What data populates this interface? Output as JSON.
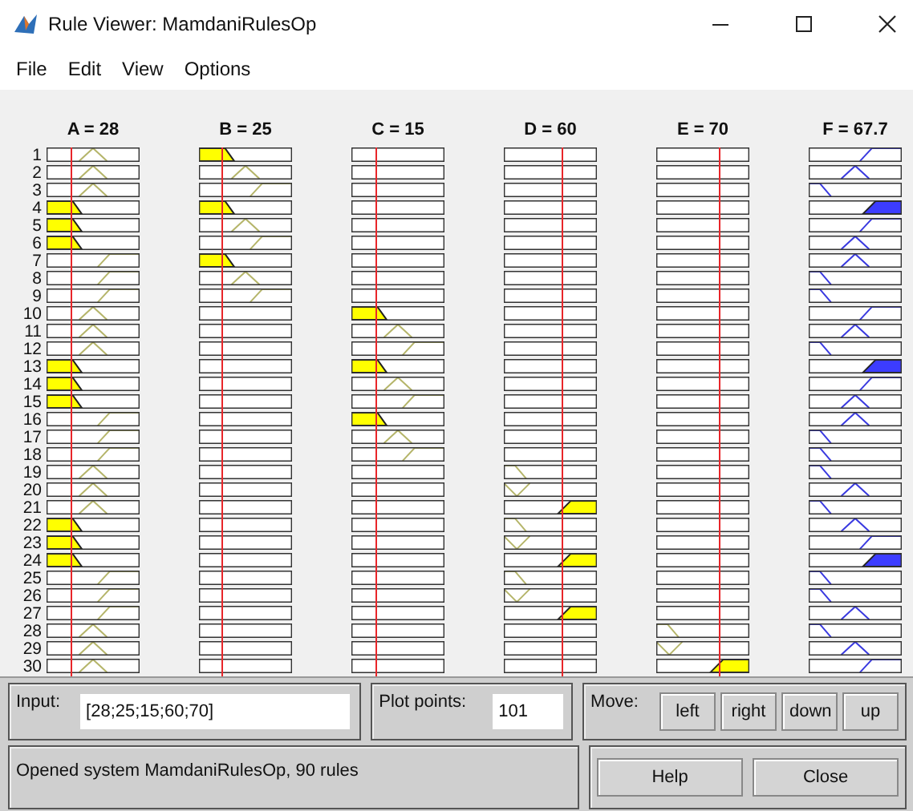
{
  "window": {
    "title": "Rule Viewer: MamdaniRulesOp"
  },
  "menu": [
    "File",
    "Edit",
    "View",
    "Options"
  ],
  "rule_numbers": [
    "1",
    "2",
    "3",
    "4",
    "5",
    "6",
    "7",
    "8",
    "9",
    "10",
    "11",
    "12",
    "13",
    "14",
    "15",
    "16",
    "17",
    "18",
    "19",
    "20",
    "21",
    "22",
    "23",
    "24",
    "25",
    "26",
    "27",
    "28",
    "29",
    "30"
  ],
  "columns": [
    {
      "title": "A = 28",
      "kind": "input",
      "rules": [
        {
          "kind": "mid"
        },
        {
          "kind": "mid"
        },
        {
          "kind": "mid"
        },
        {
          "kind": "low-fired"
        },
        {
          "kind": "low-fired"
        },
        {
          "kind": "low-fired"
        },
        {
          "kind": "high"
        },
        {
          "kind": "high"
        },
        {
          "kind": "high"
        },
        {
          "kind": "mid"
        },
        {
          "kind": "mid"
        },
        {
          "kind": "mid"
        },
        {
          "kind": "low-fired"
        },
        {
          "kind": "low-fired"
        },
        {
          "kind": "low-fired"
        },
        {
          "kind": "high"
        },
        {
          "kind": "high"
        },
        {
          "kind": "high"
        },
        {
          "kind": "mid"
        },
        {
          "kind": "mid"
        },
        {
          "kind": "mid"
        },
        {
          "kind": "low-fired"
        },
        {
          "kind": "low-fired"
        },
        {
          "kind": "low-fired"
        },
        {
          "kind": "high"
        },
        {
          "kind": "high"
        },
        {
          "kind": "high"
        },
        {
          "kind": "mid"
        },
        {
          "kind": "mid"
        },
        {
          "kind": "mid"
        }
      ]
    },
    {
      "title": "B = 25",
      "kind": "input",
      "rules": [
        {
          "kind": "low-fired"
        },
        {
          "kind": "mid"
        },
        {
          "kind": "high"
        },
        {
          "kind": "low-fired"
        },
        {
          "kind": "mid"
        },
        {
          "kind": "high"
        },
        {
          "kind": "low-fired"
        },
        {
          "kind": "mid"
        },
        {
          "kind": "high"
        },
        {
          "kind": "empty"
        },
        {
          "kind": "empty"
        },
        {
          "kind": "empty"
        },
        {
          "kind": "empty"
        },
        {
          "kind": "empty"
        },
        {
          "kind": "empty"
        },
        {
          "kind": "empty"
        },
        {
          "kind": "empty"
        },
        {
          "kind": "empty"
        },
        {
          "kind": "empty"
        },
        {
          "kind": "empty"
        },
        {
          "kind": "empty"
        },
        {
          "kind": "empty"
        },
        {
          "kind": "empty"
        },
        {
          "kind": "empty"
        },
        {
          "kind": "empty"
        },
        {
          "kind": "empty"
        },
        {
          "kind": "empty"
        },
        {
          "kind": "empty"
        },
        {
          "kind": "empty"
        },
        {
          "kind": "empty"
        }
      ]
    },
    {
      "title": "C = 15",
      "kind": "input",
      "rules": [
        {
          "kind": "empty"
        },
        {
          "kind": "empty"
        },
        {
          "kind": "empty"
        },
        {
          "kind": "empty"
        },
        {
          "kind": "empty"
        },
        {
          "kind": "empty"
        },
        {
          "kind": "empty"
        },
        {
          "kind": "empty"
        },
        {
          "kind": "empty"
        },
        {
          "kind": "low-fired"
        },
        {
          "kind": "mid"
        },
        {
          "kind": "high"
        },
        {
          "kind": "low-fired"
        },
        {
          "kind": "mid"
        },
        {
          "kind": "high"
        },
        {
          "kind": "low-fired"
        },
        {
          "kind": "mid"
        },
        {
          "kind": "high"
        },
        {
          "kind": "empty"
        },
        {
          "kind": "empty"
        },
        {
          "kind": "empty"
        },
        {
          "kind": "empty"
        },
        {
          "kind": "empty"
        },
        {
          "kind": "empty"
        },
        {
          "kind": "empty"
        },
        {
          "kind": "empty"
        },
        {
          "kind": "empty"
        },
        {
          "kind": "empty"
        },
        {
          "kind": "empty"
        },
        {
          "kind": "empty"
        }
      ]
    },
    {
      "title": "D = 60",
      "kind": "input",
      "rules": [
        {
          "kind": "empty"
        },
        {
          "kind": "empty"
        },
        {
          "kind": "empty"
        },
        {
          "kind": "empty"
        },
        {
          "kind": "empty"
        },
        {
          "kind": "empty"
        },
        {
          "kind": "empty"
        },
        {
          "kind": "empty"
        },
        {
          "kind": "empty"
        },
        {
          "kind": "empty"
        },
        {
          "kind": "empty"
        },
        {
          "kind": "empty"
        },
        {
          "kind": "empty"
        },
        {
          "kind": "empty"
        },
        {
          "kind": "empty"
        },
        {
          "kind": "empty"
        },
        {
          "kind": "empty"
        },
        {
          "kind": "empty"
        },
        {
          "kind": "low"
        },
        {
          "kind": "mid-left"
        },
        {
          "kind": "high-fired"
        },
        {
          "kind": "low"
        },
        {
          "kind": "mid-left"
        },
        {
          "kind": "high-fired"
        },
        {
          "kind": "low"
        },
        {
          "kind": "mid-left"
        },
        {
          "kind": "high-fired"
        },
        {
          "kind": "empty"
        },
        {
          "kind": "empty"
        },
        {
          "kind": "empty"
        }
      ]
    },
    {
      "title": "E = 70",
      "kind": "input",
      "rules": [
        {
          "kind": "empty"
        },
        {
          "kind": "empty"
        },
        {
          "kind": "empty"
        },
        {
          "kind": "empty"
        },
        {
          "kind": "empty"
        },
        {
          "kind": "empty"
        },
        {
          "kind": "empty"
        },
        {
          "kind": "empty"
        },
        {
          "kind": "empty"
        },
        {
          "kind": "empty"
        },
        {
          "kind": "empty"
        },
        {
          "kind": "empty"
        },
        {
          "kind": "empty"
        },
        {
          "kind": "empty"
        },
        {
          "kind": "empty"
        },
        {
          "kind": "empty"
        },
        {
          "kind": "empty"
        },
        {
          "kind": "empty"
        },
        {
          "kind": "empty"
        },
        {
          "kind": "empty"
        },
        {
          "kind": "empty"
        },
        {
          "kind": "empty"
        },
        {
          "kind": "empty"
        },
        {
          "kind": "empty"
        },
        {
          "kind": "empty"
        },
        {
          "kind": "empty"
        },
        {
          "kind": "empty"
        },
        {
          "kind": "low"
        },
        {
          "kind": "mid-left"
        },
        {
          "kind": "high-fired"
        }
      ]
    },
    {
      "title": "F = 67.7",
      "kind": "output",
      "rules": [
        {
          "kind": "high"
        },
        {
          "kind": "mid"
        },
        {
          "kind": "low"
        },
        {
          "kind": "high-fired"
        },
        {
          "kind": "high"
        },
        {
          "kind": "mid"
        },
        {
          "kind": "mid"
        },
        {
          "kind": "low"
        },
        {
          "kind": "low"
        },
        {
          "kind": "high"
        },
        {
          "kind": "mid"
        },
        {
          "kind": "low"
        },
        {
          "kind": "high-fired"
        },
        {
          "kind": "high"
        },
        {
          "kind": "mid"
        },
        {
          "kind": "mid"
        },
        {
          "kind": "low"
        },
        {
          "kind": "low"
        },
        {
          "kind": "low"
        },
        {
          "kind": "mid"
        },
        {
          "kind": "low"
        },
        {
          "kind": "mid"
        },
        {
          "kind": "high"
        },
        {
          "kind": "high-fired"
        },
        {
          "kind": "low"
        },
        {
          "kind": "low"
        },
        {
          "kind": "mid"
        },
        {
          "kind": "low"
        },
        {
          "kind": "mid"
        },
        {
          "kind": "high"
        }
      ]
    }
  ],
  "input": {
    "label": "Input:",
    "value": "[28;25;15;60;70]"
  },
  "plot_points": {
    "label": "Plot points:",
    "value": "101"
  },
  "move": {
    "label": "Move:",
    "buttons": [
      "left",
      "right",
      "down",
      "up"
    ]
  },
  "status": "Opened system MamdaniRulesOp, 90 rules",
  "buttons": [
    "Help",
    "Close"
  ]
}
